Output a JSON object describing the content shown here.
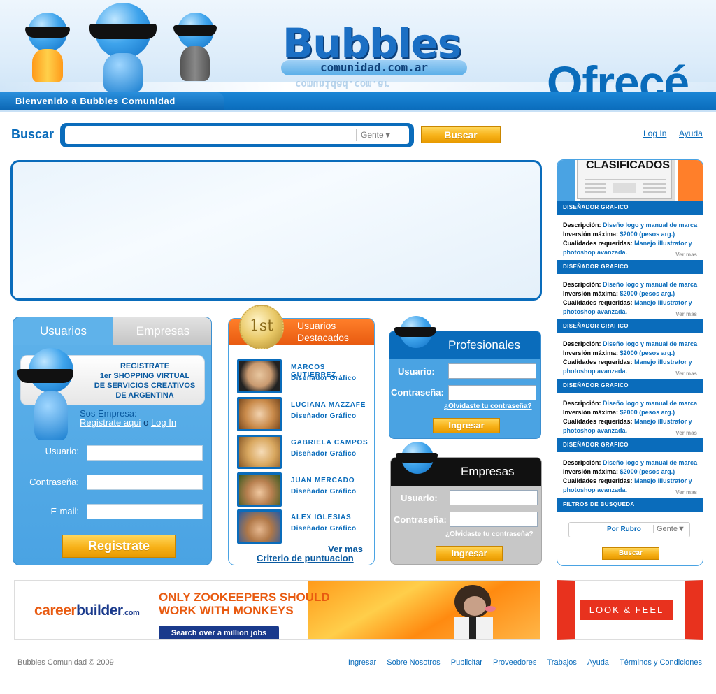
{
  "header": {
    "logo_title": "Bubbles",
    "logo_subtitle": "comunidad.com.ar",
    "slogan": "Ofrecé",
    "welcome": "Bienvenido a Bubbles Comunidad"
  },
  "search": {
    "label": "Buscar",
    "value": "",
    "filter": "Gente▼",
    "button": "Buscar"
  },
  "top_links": {
    "login": "Log In",
    "help": "Ayuda"
  },
  "user_panel": {
    "tabs": [
      "Usuarios",
      "Empresas"
    ],
    "register_card": [
      "REGISTRATE",
      "1er SHOPPING VIRTUAL",
      "DE SERVICIOS CREATIVOS",
      "DE ARGENTINA"
    ],
    "sos_empresa": "Sos Empresa:",
    "register_here": "Registrate aqui",
    "or": "o",
    "login": "Log In",
    "fields": [
      "Usuario:",
      "Contraseña:",
      "E-mail:"
    ],
    "button": "Registrate"
  },
  "featured": {
    "medal": "1st",
    "title_line1": "Usuarios",
    "title_line2": "Destacados",
    "users": [
      {
        "name": "MARCOS GUTIERREZ",
        "role": "Diseñador Gráfico"
      },
      {
        "name": "LUCIANA MAZZAFE",
        "role": "Diseñador Gráfico"
      },
      {
        "name": "GABRIELA CAMPOS",
        "role": "Diseñador Gráfico"
      },
      {
        "name": "JUAN MERCADO",
        "role": "Diseñador Gráfico"
      },
      {
        "name": "ALEX IGLESIAS",
        "role": "Diseñador Gráfico"
      }
    ],
    "more": "Ver mas",
    "criteria": "Criterio de puntuacion"
  },
  "profesionales": {
    "title": "Profesionales",
    "user_label": "Usuario:",
    "pass_label": "Contraseña:",
    "forgot": "¿Olvidaste tu contraseña?",
    "button": "Ingresar"
  },
  "empresas": {
    "title": "Empresas",
    "user_label": "Usuario:",
    "pass_label": "Contraseña:",
    "forgot": "¿Olvidaste tu contraseña?",
    "button": "Ingresar"
  },
  "clasificados": {
    "title": "CLASIFICADOS",
    "items": [
      {
        "category": "DISEÑADOR GRAFICO",
        "desc_label": "Descripción:",
        "desc": "Diseño logo y manual de marca",
        "inv_label": "Inversión máxima:",
        "inv": "$2000 (pesos arg.)",
        "cual_label": "Cualidades requeridas:",
        "cual": "Manejo illustrator y photoshop avanzada.",
        "more": "Ver mas"
      },
      {
        "category": "DISEÑADOR GRAFICO",
        "desc_label": "Descripción:",
        "desc": "Diseño logo y manual de marca",
        "inv_label": "Inversión máxima:",
        "inv": "$2000 (pesos arg.)",
        "cual_label": "Cualidades requeridas:",
        "cual": "Manejo illustrator y photoshop avanzada.",
        "more": "Ver mas"
      },
      {
        "category": "DISEÑADOR GRAFICO",
        "desc_label": "Descripción:",
        "desc": "Diseño logo y manual de marca",
        "inv_label": "Inversión máxima:",
        "inv": "$2000 (pesos arg.)",
        "cual_label": "Cualidades requeridas:",
        "cual": "Manejo illustrator y photoshop avanzada.",
        "more": "Ver mas"
      },
      {
        "category": "DISEÑADOR GRAFICO",
        "desc_label": "Descripción:",
        "desc": "Diseño logo y manual de marca",
        "inv_label": "Inversión máxima:",
        "inv": "$2000 (pesos arg.)",
        "cual_label": "Cualidades requeridas:",
        "cual": "Manejo illustrator y photoshop avanzada.",
        "more": "Ver mas"
      },
      {
        "category": "DISEÑADOR GRAFICO",
        "desc_label": "Descripción:",
        "desc": "Diseño logo y manual de marca",
        "inv_label": "Inversión máxima:",
        "inv": "$2000 (pesos arg.)",
        "cual_label": "Cualidades requeridas:",
        "cual": "Manejo illustrator y photoshop avanzada.",
        "more": "Ver mas"
      }
    ],
    "filters_title": "FILTROS DE BUSQUEDA",
    "filter_rubro": "Por Rubro",
    "filter_gente": "Gente▼",
    "button": "Buscar"
  },
  "ads": {
    "career_logo_a": "career",
    "career_logo_b": "builder",
    "career_logo_c": ".com",
    "career_line1": "ONLY ZOOKEEPERS SHOULD",
    "career_line2": "WORK WITH MONKEYS",
    "career_cta": "Search over a million jobs",
    "look_feel": "LOOK & FEEL"
  },
  "footer": {
    "copyright": "Bubbles Comunidad  © 2009",
    "links": [
      "Ingresar",
      "Sobre Nosotros",
      "Publicitar",
      "Proveedores",
      "Trabajos",
      "Ayuda",
      "Términos y Condiciones"
    ]
  },
  "colors": {
    "brand_blue": "#0a6cbb",
    "light_blue": "#4aa3e3",
    "orange": "#e85a10",
    "gold": "#f7b118"
  }
}
